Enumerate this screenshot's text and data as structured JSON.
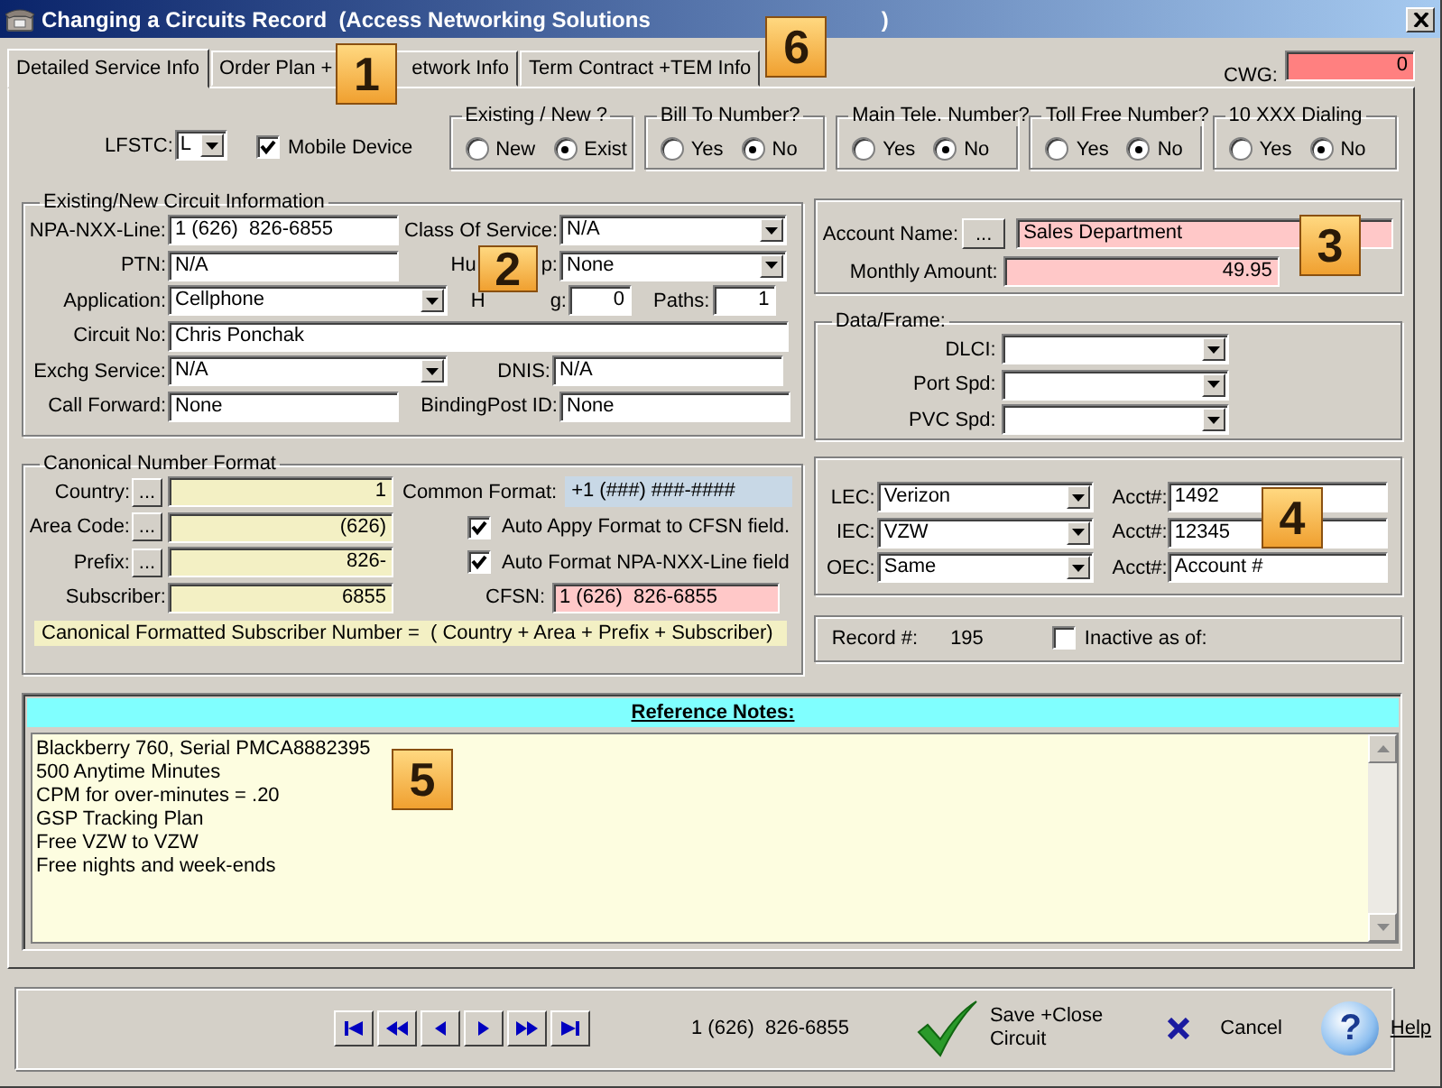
{
  "window": {
    "title": "Changing a Circuits Record  (Access Networking Solutions",
    "title_end": ")"
  },
  "tabs": [
    {
      "label": "Detailed Service Info",
      "selected": true
    },
    {
      "label": "Order Plan +",
      "label_after": "etwork Info",
      "selected": false
    },
    {
      "label": "Term Contract +TEM Info",
      "selected": false
    }
  ],
  "cwg": {
    "label": "CWG:",
    "value": "0"
  },
  "lfstc": {
    "label": "LFSTC:",
    "value": "L"
  },
  "mobile_device": {
    "label": "Mobile Device",
    "checked": true
  },
  "radio_groups": [
    {
      "title": "Existing / New ?",
      "options": [
        {
          "label": "New",
          "selected": false
        },
        {
          "label": "Exist",
          "selected": true
        }
      ]
    },
    {
      "title": "Bill To Number?",
      "options": [
        {
          "label": "Yes",
          "selected": false
        },
        {
          "label": "No",
          "selected": true
        }
      ]
    },
    {
      "title": "Main Tele. Number?",
      "options": [
        {
          "label": "Yes",
          "selected": false
        },
        {
          "label": "No",
          "selected": true
        }
      ]
    },
    {
      "title": "Toll Free Number?",
      "options": [
        {
          "label": "Yes",
          "selected": false
        },
        {
          "label": "No",
          "selected": true
        }
      ]
    },
    {
      "title": "10 XXX Dialing",
      "options": [
        {
          "label": "Yes",
          "selected": false
        },
        {
          "label": "No",
          "selected": true
        }
      ]
    }
  ],
  "circuit_info": {
    "title": "Existing/New Circuit Information",
    "npa": {
      "label": "NPA-NXX-Line:",
      "value": "1 (626)  826-6855"
    },
    "class_of_service": {
      "label": "Class Of Service:",
      "value": "N/A"
    },
    "ptn": {
      "label": "PTN:",
      "value": "N/A"
    },
    "hunt": {
      "label": "Hu",
      "label_after": "p:",
      "value": "None"
    },
    "application": {
      "label": "Application:",
      "value": "Cellphone"
    },
    "hunting": {
      "label": "H",
      "label_after": "g:",
      "value": "0"
    },
    "paths": {
      "label": "Paths:",
      "value": "1"
    },
    "circuit_no": {
      "label": "Circuit No:",
      "value": "Chris Ponchak"
    },
    "exchg": {
      "label": "Exchg Service:",
      "value": "N/A"
    },
    "dnis": {
      "label": "DNIS:",
      "value": "N/A"
    },
    "call_forward": {
      "label": "Call Forward:",
      "value": "None"
    },
    "binding_post": {
      "label": "BindingPost ID:",
      "value": "None"
    }
  },
  "account": {
    "name_label": "Account Name:",
    "button": "...",
    "name": "Sales Department",
    "amount_label": "Monthly Amount:",
    "amount": "49.95"
  },
  "data_frame": {
    "title": "Data/Frame:",
    "fields": [
      {
        "label": "DLCI:"
      },
      {
        "label": "Port Spd:"
      },
      {
        "label": "PVC Spd:"
      }
    ]
  },
  "canonical": {
    "title": "Canonical Number Format",
    "parts": [
      {
        "label": "Country:",
        "button": "...",
        "value": "1"
      },
      {
        "label": "Area Code:",
        "button": "...",
        "value": "(626)"
      },
      {
        "label": "Prefix:",
        "button": "...",
        "value": "826-"
      },
      {
        "label": "Subscriber:",
        "value": "6855"
      }
    ],
    "common_format": {
      "label": "Common Format:",
      "value": "+1 (###) ###-####"
    },
    "options": [
      {
        "label": "Auto Appy Format to CFSN field.",
        "checked": true
      },
      {
        "label": "Auto Format NPA-NXX-Line field",
        "checked": true
      }
    ],
    "cfsn": {
      "label": "CFSN:",
      "value": "1 (626)  826-6855"
    },
    "formula": "Canonical Formatted Subscriber Number =  ( Country + Area + Prefix + Subscriber)"
  },
  "carriers": [
    {
      "label": "LEC:",
      "value": "Verizon",
      "acct_label": "Acct#:",
      "acct": "1492"
    },
    {
      "label": "IEC:",
      "value": "VZW",
      "acct_label": "Acct#:",
      "acct": "12345"
    },
    {
      "label": "OEC:",
      "value": "Same",
      "acct_label": "Acct#:",
      "acct": "Account #"
    }
  ],
  "record": {
    "label": "Record #:",
    "value": "195",
    "inactive_label": "Inactive as of:",
    "inactive": false
  },
  "notes": {
    "title": "Reference Notes:",
    "lines": [
      "Blackberry 760, Serial PMCA8882395",
      "500 Anytime Minutes",
      "CPM for over-minutes = .20",
      "GSP Tracking Plan",
      "Free VZW to VZW",
      "Free nights and week-ends"
    ]
  },
  "footer": {
    "phone": "1 (626)  826-6855",
    "save": [
      "Save +Close",
      "Circuit"
    ],
    "cancel": "Cancel",
    "help": "Help",
    "help_mark": "?"
  },
  "callouts": [
    "1",
    "6",
    "2",
    "3",
    "4",
    "5"
  ]
}
